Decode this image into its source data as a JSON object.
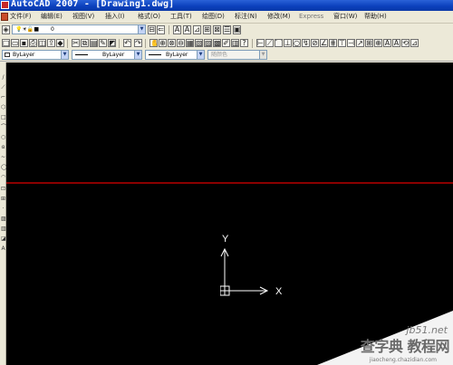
{
  "window": {
    "title": "AutoCAD 2007 - [Drawing1.dwg]"
  },
  "menubar": {
    "items": [
      "文件(F)",
      "编辑(E)",
      "视图(V)",
      "插入(I)",
      "格式(O)",
      "工具(T)",
      "绘图(D)",
      "标注(N)",
      "修改(M)",
      "Express",
      "窗口(W)",
      "帮助(H)"
    ]
  },
  "layers": {
    "current_layer": "0"
  },
  "properties": {
    "color": "ByLayer",
    "linetype": "ByLayer",
    "lineweight": "ByLayer",
    "plotstyle": "随颜色"
  },
  "canvas": {
    "background": "#000000",
    "ucs_x_label": "X",
    "ucs_y_label": "Y",
    "rule_color": "#8b0000"
  },
  "watermark": {
    "url": "jb51.net",
    "text": "查字典 教程网",
    "sub": "jiaocheng.chazidian.com"
  },
  "colors": {
    "titlebar": "#0a3fbb",
    "ui": "#ece9d8"
  }
}
